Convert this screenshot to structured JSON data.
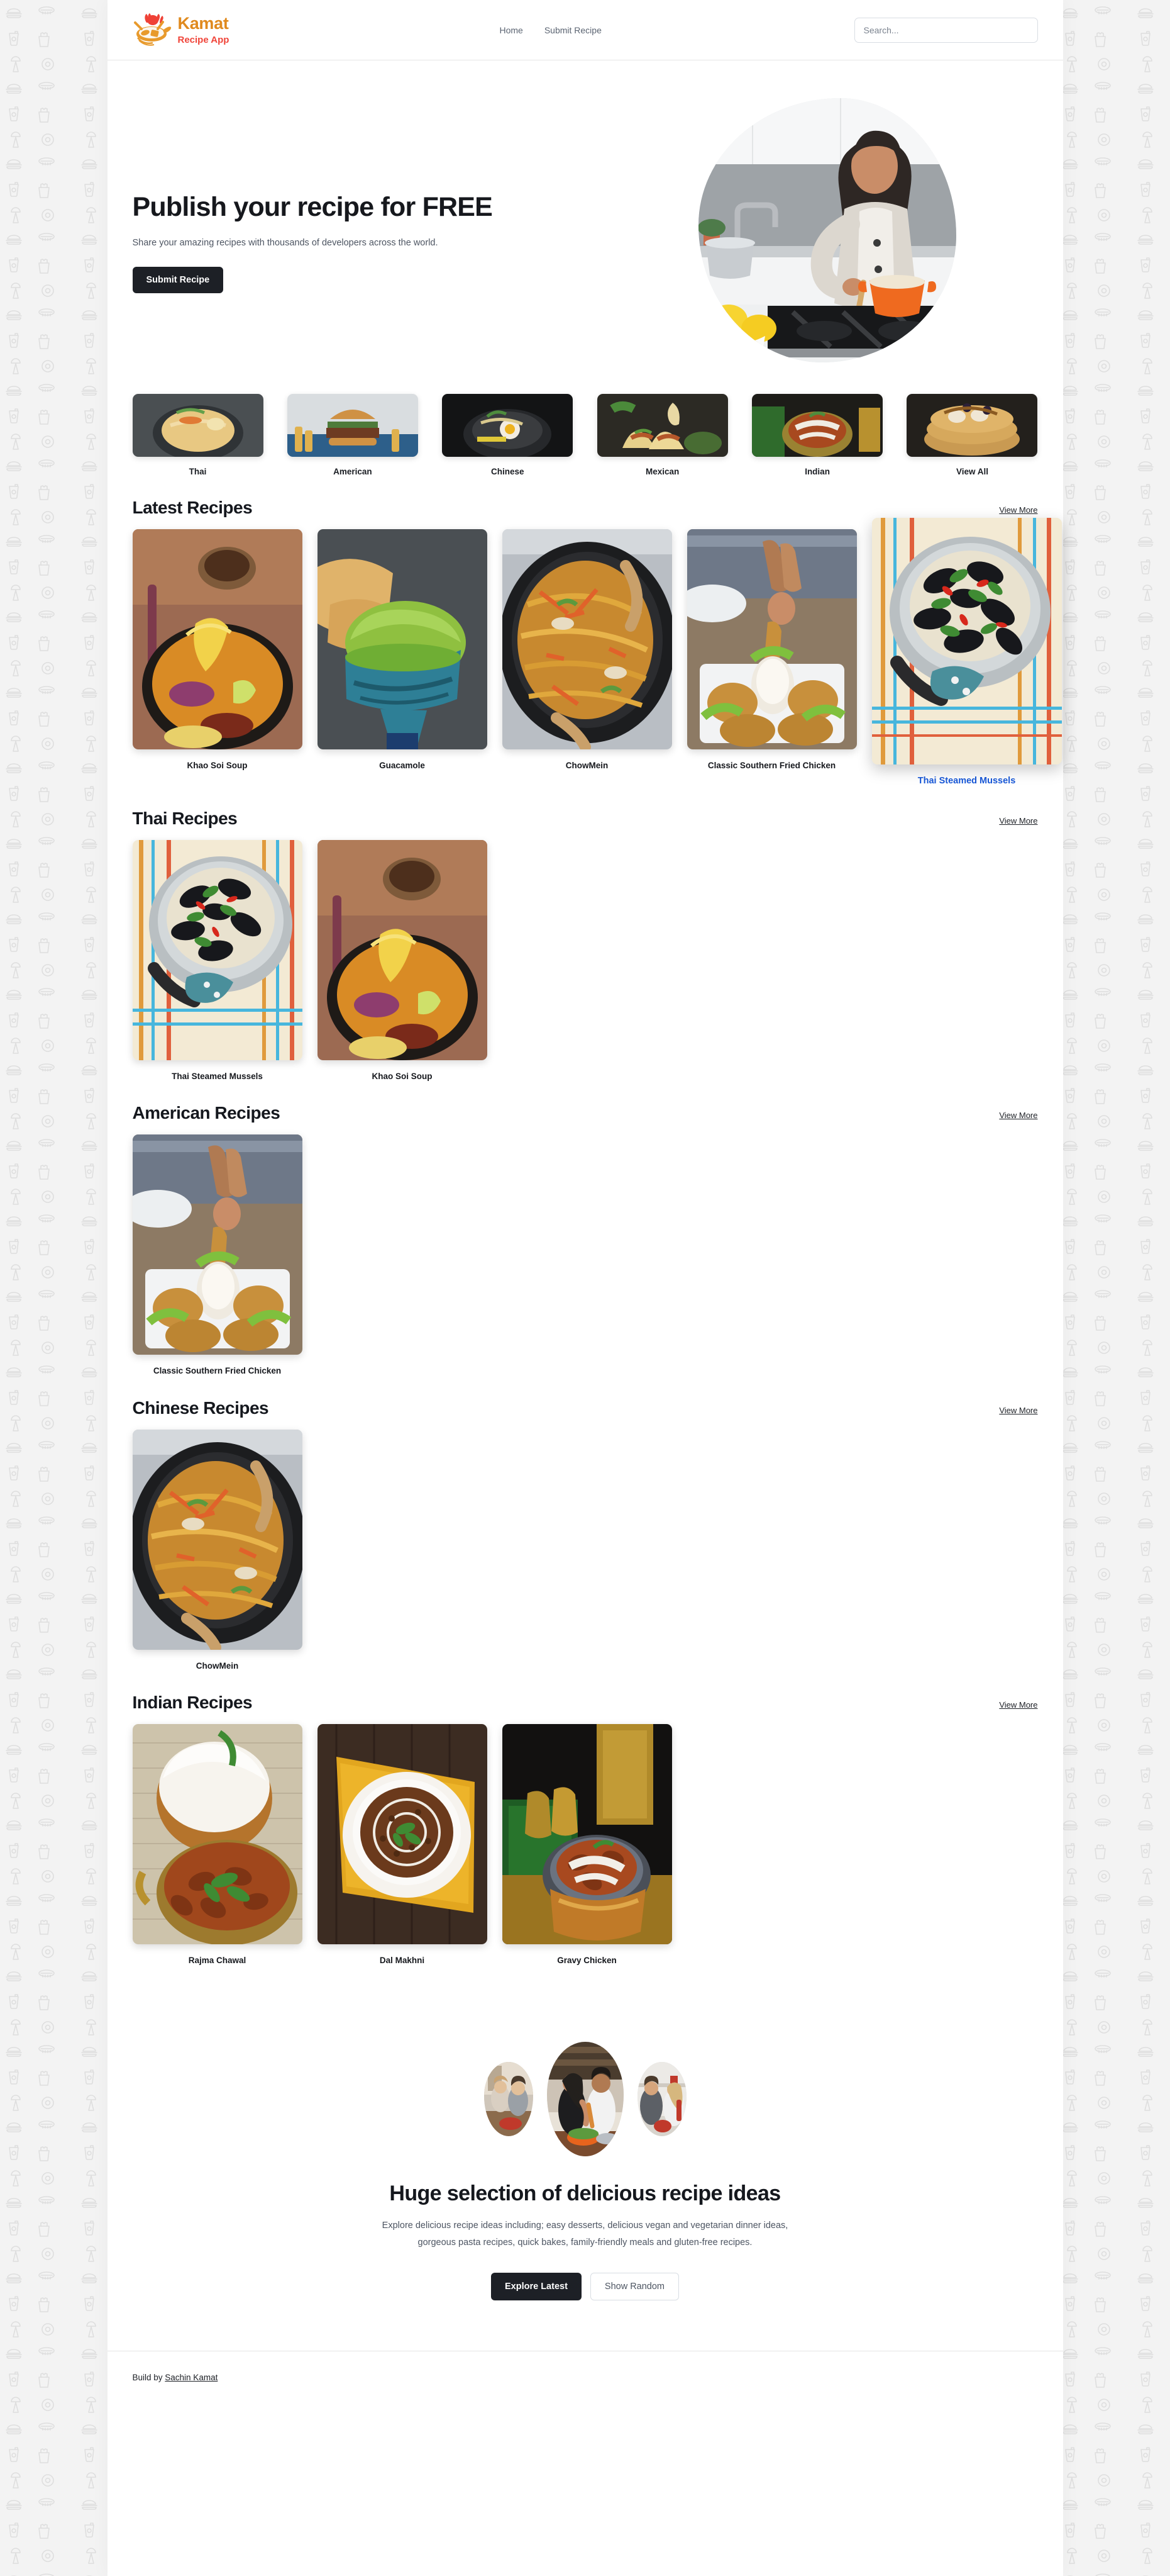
{
  "header": {
    "brand": {
      "line1": "Kamat",
      "line2": "Recipe App",
      "logo_icon": "pan-with-utensils-icon"
    },
    "nav": [
      {
        "label": "Home",
        "name": "nav-home"
      },
      {
        "label": "Submit Recipe",
        "name": "nav-submit-recipe"
      }
    ],
    "search": {
      "placeholder": "Search...",
      "value": ""
    }
  },
  "hero": {
    "title": "Publish your recipe for FREE",
    "subtitle": "Share your amazing recipes with thousands of developers across the world.",
    "cta_label": "Submit Recipe",
    "image_alt": "woman-cooking-in-kitchen"
  },
  "categories": [
    {
      "label": "Thai",
      "image_alt": "thai-noodle-soup-bowl"
    },
    {
      "label": "American",
      "image_alt": "burger-and-fries"
    },
    {
      "label": "Chinese",
      "image_alt": "ramen-bowl-with-egg"
    },
    {
      "label": "Mexican",
      "image_alt": "tacos"
    },
    {
      "label": "Indian",
      "image_alt": "indian-curry-bowl"
    },
    {
      "label": "View All",
      "image_alt": "pancake-stack"
    }
  ],
  "sections": [
    {
      "title": "Latest Recipes",
      "view_more": "View More",
      "cards": [
        {
          "name": "Khao Soi Soup",
          "hovered": false,
          "image_alt": "khao-soi-soup"
        },
        {
          "name": "Guacamole",
          "hovered": false,
          "image_alt": "guacamole-bowl"
        },
        {
          "name": "ChowMein",
          "hovered": false,
          "image_alt": "chow-mein-pan"
        },
        {
          "name": "Classic Southern Fried Chicken",
          "hovered": false,
          "image_alt": "fried-chicken-platter"
        },
        {
          "name": "Thai Steamed Mussels",
          "hovered": true,
          "image_alt": "thai-steamed-mussels-pot"
        }
      ]
    },
    {
      "title": "Thai Recipes",
      "view_more": "View More",
      "cards": [
        {
          "name": "Thai Steamed Mussels",
          "hovered": false,
          "image_alt": "thai-steamed-mussels-pot"
        },
        {
          "name": "Khao Soi Soup",
          "hovered": false,
          "image_alt": "khao-soi-soup"
        }
      ]
    },
    {
      "title": "American Recipes",
      "view_more": "View More",
      "cards": [
        {
          "name": "Classic Southern Fried Chicken",
          "hovered": false,
          "image_alt": "fried-chicken-platter"
        }
      ]
    },
    {
      "title": "Chinese Recipes",
      "view_more": "View More",
      "cards": [
        {
          "name": "ChowMein",
          "hovered": false,
          "image_alt": "chow-mein-pan"
        }
      ]
    },
    {
      "title": "Indian Recipes",
      "view_more": "View More",
      "cards": [
        {
          "name": "Rajma Chawal",
          "hovered": false,
          "image_alt": "rajma-chawal"
        },
        {
          "name": "Dal Makhni",
          "hovered": false,
          "image_alt": "dal-makhni-bowl"
        },
        {
          "name": "Gravy Chicken",
          "hovered": false,
          "image_alt": "gravy-chicken-copper-bowl"
        }
      ]
    }
  ],
  "cta": {
    "title": "Huge selection of delicious recipe ideas",
    "text": "Explore delicious recipe ideas including; easy desserts, delicious vegan and vegetarian dinner ideas, gorgeous pasta recipes, quick bakes, family-friendly meals and gluten-free recipes.",
    "primary_label": "Explore Latest",
    "secondary_label": "Show Random",
    "photos": [
      {
        "alt": "couple-cooking-left",
        "size": "small"
      },
      {
        "alt": "couple-cooking-center",
        "size": "large"
      },
      {
        "alt": "couple-cooking-right",
        "size": "small"
      }
    ]
  },
  "footer": {
    "prefix": "Build by ",
    "link_label": "Sachin Kamat"
  },
  "colors": {
    "brand_orange": "#e08a1e",
    "brand_red": "#f0453a",
    "dark": "#1d2026",
    "hover_blue": "#1858d8",
    "muted": "#4d5562"
  }
}
